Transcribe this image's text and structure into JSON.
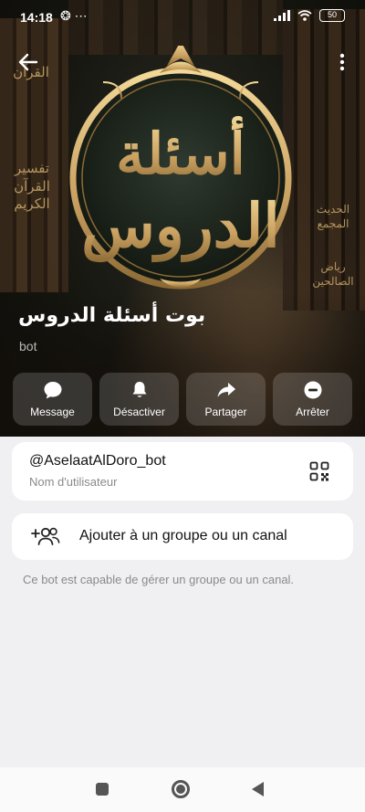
{
  "status": {
    "time": "14:18",
    "left_icons": "❂ ⋯",
    "battery": "50"
  },
  "header": {
    "emblem_line1": "أسئلة",
    "emblem_line2": "الدروس",
    "spine_left_1": "القرآن",
    "spine_left_2": "تفسير القرآن الكريم",
    "spine_right_1": "الحديث المجمع",
    "spine_right_2": "رياض الصالحين"
  },
  "bot": {
    "title": "بوت أسئلة الدروس",
    "subtitle": "bot"
  },
  "actions": [
    {
      "label": "Message",
      "icon": "chat-bubble-icon"
    },
    {
      "label": "Désactiver",
      "icon": "bell-icon"
    },
    {
      "label": "Partager",
      "icon": "share-arrow-icon"
    },
    {
      "label": "Arrêter",
      "icon": "stop-circle-icon"
    }
  ],
  "username_card": {
    "username": "@AselaatAlDoro_bot",
    "caption": "Nom d'utilisateur",
    "icon": "qr-code-icon"
  },
  "add_card": {
    "label": "Ajouter à un groupe ou un canal",
    "icon": "add-people-icon"
  },
  "note": "Ce bot est capable de gérer un groupe ou un canal.",
  "colors": {
    "accent_gold": "#c9a86a",
    "background": "#f0f0f3",
    "card": "#ffffff"
  }
}
